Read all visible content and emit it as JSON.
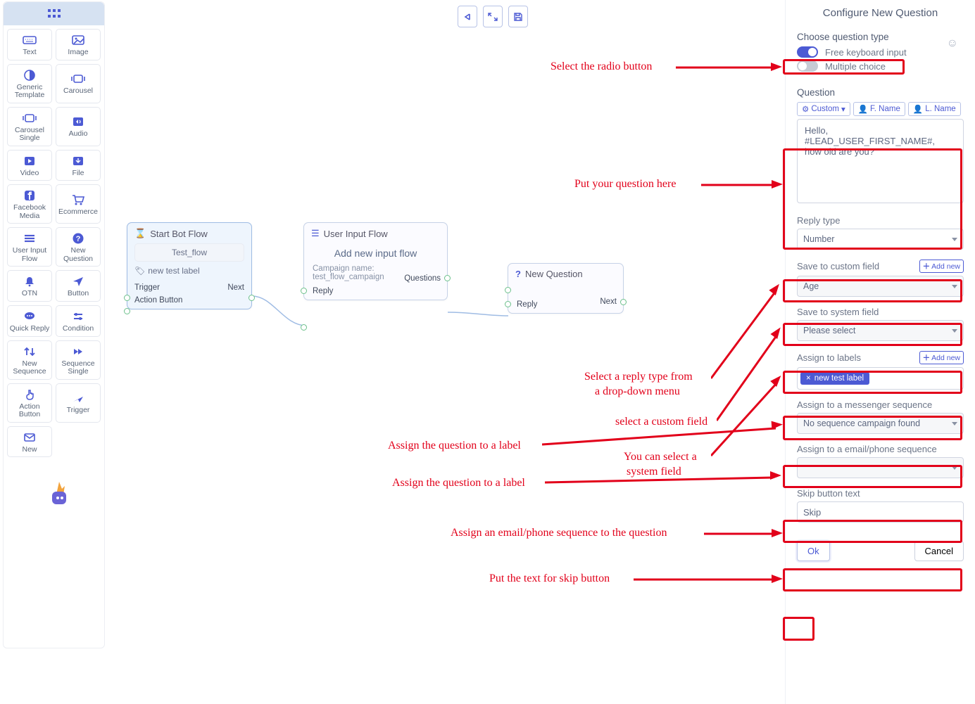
{
  "sidebar": {
    "items": [
      {
        "label": "Text",
        "icon": "keyboard"
      },
      {
        "label": "Image",
        "icon": "image"
      },
      {
        "label": "Generic Template",
        "icon": "circle-half"
      },
      {
        "label": "Carousel",
        "icon": "carousel"
      },
      {
        "label": "Carousel Single",
        "icon": "carousel"
      },
      {
        "label": "Audio",
        "icon": "audio"
      },
      {
        "label": "Video",
        "icon": "video"
      },
      {
        "label": "File",
        "icon": "file"
      },
      {
        "label": "Facebook Media",
        "icon": "facebook"
      },
      {
        "label": "Ecommerce",
        "icon": "cart"
      },
      {
        "label": "User Input Flow",
        "icon": "menu"
      },
      {
        "label": "New Question",
        "icon": "question"
      },
      {
        "label": "OTN",
        "icon": "bell"
      },
      {
        "label": "Button",
        "icon": "send"
      },
      {
        "label": "Quick Reply",
        "icon": "chat"
      },
      {
        "label": "Condition",
        "icon": "sliders"
      },
      {
        "label": "New Sequence",
        "icon": "sort"
      },
      {
        "label": "Sequence Single",
        "icon": "forward"
      },
      {
        "label": "Action Button",
        "icon": "tap"
      },
      {
        "label": "Trigger",
        "icon": "plane"
      },
      {
        "label": "New",
        "icon": "mail"
      }
    ]
  },
  "toolbar": {
    "undo": "undo",
    "fit": "fit",
    "save": "save"
  },
  "nodes": {
    "start": {
      "title": "Start Bot Flow",
      "flow_name": "Test_flow",
      "label": "new test label",
      "port_trigger": "Trigger",
      "port_next": "Next",
      "port_action": "Action Button"
    },
    "input": {
      "title": "User Input Flow",
      "add": "Add new input flow",
      "campaign": "Campaign name: test_flow_campaign",
      "port_reply": "Reply",
      "port_questions": "Questions"
    },
    "question": {
      "title": "New Question",
      "port_reply": "Reply",
      "port_next": "Next"
    }
  },
  "panel": {
    "title": "Configure New Question",
    "choose_label": "Choose question type",
    "opt_free": "Free keyboard input",
    "opt_multiple": "Multiple choice",
    "question_heading": "Question",
    "token_custom": "Custom",
    "token_fname": "F. Name",
    "token_lname": "L. Name",
    "question_value": "Hello, #LEAD_USER_FIRST_NAME#, how old are you?",
    "reply_type_label": "Reply type",
    "reply_type_value": "Number",
    "save_custom_label": "Save to custom field",
    "save_custom_value": "Age",
    "save_system_label": "Save to system field",
    "save_system_value": "Please select",
    "assign_labels_label": "Assign to labels",
    "assign_labels_chip": "new test label",
    "assign_msgr_label": "Assign to a messenger sequence",
    "assign_msgr_value": "No sequence campaign found",
    "assign_email_label": "Assign to a email/phone sequence",
    "assign_email_value": "",
    "skip_label": "Skip button text",
    "skip_value": "Skip",
    "addnew": "Add new",
    "ok": "Ok",
    "cancel": "Cancel"
  },
  "annotations": {
    "a1": "Select the radio button",
    "a2": "Put your question here",
    "a3": "Select a reply type from",
    "a3b": "a drop-down menu",
    "a4": "select a custom field",
    "a5": "Assign the question to a label",
    "a6": "You can select a",
    "a6b": "system field",
    "a7": "Assign the question to a label",
    "a8": "Assign an email/phone sequence to the question",
    "a9": "Put the text for skip button"
  }
}
